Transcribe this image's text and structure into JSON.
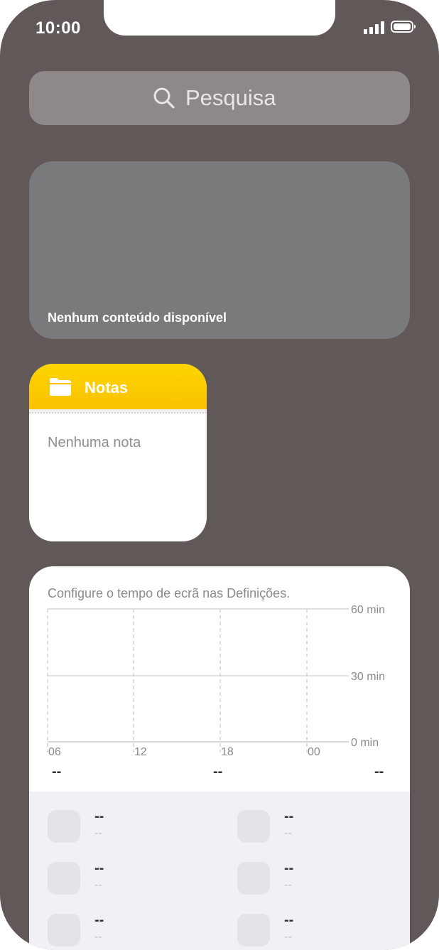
{
  "status": {
    "time": "10:00"
  },
  "search": {
    "placeholder": "Pesquisa"
  },
  "widget_empty": {
    "label": "Nenhum conteúdo disponível"
  },
  "notes_widget": {
    "title": "Notas",
    "empty": "Nenhuma nota"
  },
  "screen_time": {
    "message": "Configure o tempo de ecrã nas Definições.",
    "y_ticks": [
      "60 min",
      "30 min",
      "0 min"
    ],
    "x_ticks": [
      "06",
      "12",
      "18",
      "00"
    ],
    "totals": [
      "--",
      "--",
      "--"
    ],
    "apps": [
      {
        "value": "--",
        "sub": "--"
      },
      {
        "value": "--",
        "sub": "--"
      },
      {
        "value": "--",
        "sub": "--"
      },
      {
        "value": "--",
        "sub": "--"
      },
      {
        "value": "--",
        "sub": "--"
      },
      {
        "value": "--",
        "sub": "--"
      }
    ]
  },
  "colors": {
    "background": "#615858",
    "search": "#8e8888",
    "empty_widget": "#7a797b",
    "notes_accent": "#f8c200"
  }
}
